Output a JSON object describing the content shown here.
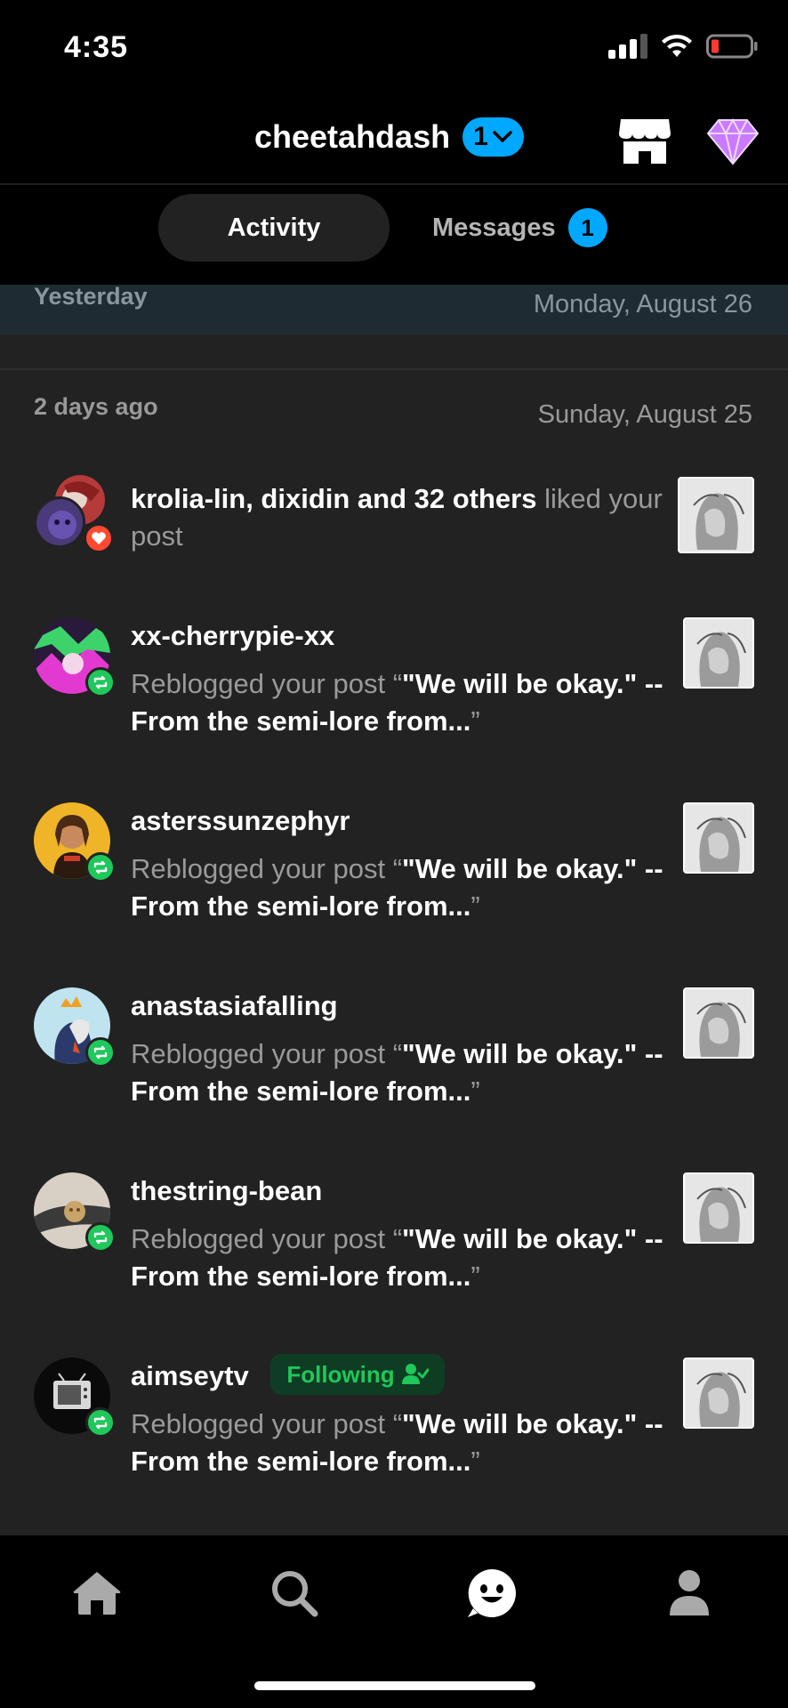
{
  "status": {
    "time": "4:35"
  },
  "header": {
    "blog_name": "cheetahdash",
    "blog_count": "1"
  },
  "tabs": {
    "activity": "Activity",
    "messages": "Messages",
    "messages_badge": "1"
  },
  "sections": [
    {
      "relative": "Yesterday",
      "date": "Monday, August 26"
    },
    {
      "relative": "2 days ago",
      "date": "Sunday, August 25"
    }
  ],
  "notifications": [
    {
      "users": "krolia-lin, dixidin and 32 others",
      "action": "liked your post",
      "type": "like"
    },
    {
      "user": "xx-cherrypie-xx",
      "action": "Reblogged your post",
      "quote_open": "“",
      "quote_text": "\"We will be okay.\" -- From the semi-lore from...",
      "quote_close": "”",
      "type": "reblog"
    },
    {
      "user": "asterssunzephyr",
      "action": "Reblogged your post",
      "quote_open": "“",
      "quote_text": "\"We will be okay.\" -- From the semi-lore from...",
      "quote_close": "”",
      "type": "reblog"
    },
    {
      "user": "anastasiafalling",
      "action": "Reblogged your post",
      "quote_open": "“",
      "quote_text": "\"We will be okay.\" -- From the semi-lore from...",
      "quote_close": "”",
      "type": "reblog"
    },
    {
      "user": "thestring-bean",
      "action": "Reblogged your post",
      "quote_open": "“",
      "quote_text": "\"We will be okay.\" -- From the semi-lore from...",
      "quote_close": "”",
      "type": "reblog"
    },
    {
      "user": "aimseytv",
      "following": "Following",
      "action": "Reblogged your post",
      "quote_open": "“",
      "quote_text": "\"We will be okay.\" -- From the semi-lore from...",
      "quote_close": "”",
      "type": "reblog"
    }
  ],
  "icons": {
    "shop": "shop-icon",
    "gem": "gem-icon",
    "home": "home-icon",
    "search": "search-icon",
    "activity": "activity-face-icon",
    "account": "account-icon"
  },
  "colors": {
    "accent_blue": "#00a8ff",
    "reblog_green": "#1ec85a",
    "like_red": "#ff4930",
    "gem_purple": "#c97bff"
  }
}
